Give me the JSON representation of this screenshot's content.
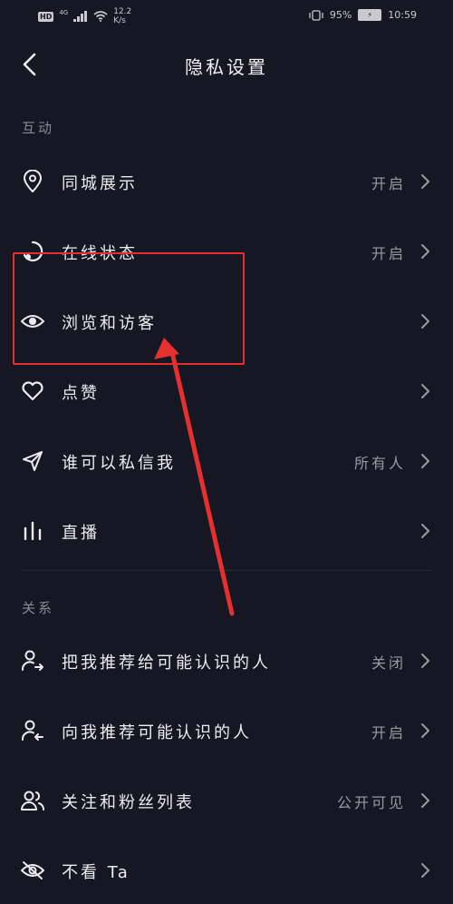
{
  "status_bar": {
    "hd": "HD",
    "network": "4G",
    "speed_value": "12.2",
    "speed_unit": "K/s",
    "battery_percent": "95%",
    "time": "10:59"
  },
  "header": {
    "title": "隐私设置"
  },
  "sections": {
    "interaction": {
      "label": "互动"
    },
    "relationship": {
      "label": "关系"
    }
  },
  "rows": [
    {
      "label": "同城展示",
      "value": "开启",
      "icon": "location-pin-icon"
    },
    {
      "label": "在线状态",
      "value": "开启",
      "icon": "online-status-icon"
    },
    {
      "label": "浏览和访客",
      "value": "",
      "icon": "eye-icon"
    },
    {
      "label": "点赞",
      "value": "",
      "icon": "heart-icon"
    },
    {
      "label": "谁可以私信我",
      "value": "所有人",
      "icon": "send-icon"
    },
    {
      "label": "直播",
      "value": "",
      "icon": "live-bars-icon"
    },
    {
      "label": "把我推荐给可能认识的人",
      "value": "关闭",
      "icon": "user-share-icon"
    },
    {
      "label": "向我推荐可能认识的人",
      "value": "开启",
      "icon": "user-recommend-icon"
    },
    {
      "label": "关注和粉丝列表",
      "value": "公开可见",
      "icon": "users-icon"
    },
    {
      "label": "不看 Ta",
      "value": "",
      "icon": "eye-off-icon"
    }
  ],
  "colors": {
    "background": "#161723",
    "annotation": "#e53030"
  }
}
